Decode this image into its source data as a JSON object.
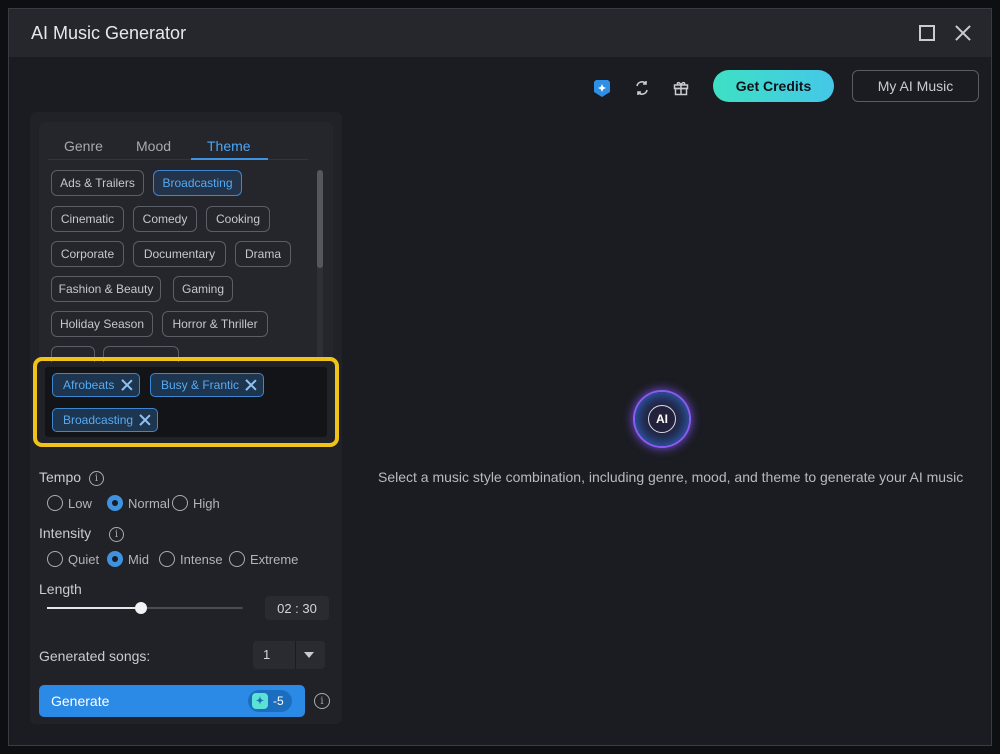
{
  "window": {
    "title": "AI Music Generator"
  },
  "toolbar": {
    "get_credits": "Get Credits",
    "my_ai_music": "My AI Music"
  },
  "tabs": [
    "Genre",
    "Mood",
    "Theme"
  ],
  "theme_chips": [
    {
      "label": "Ads & Trailers",
      "selected": false
    },
    {
      "label": "Broadcasting",
      "selected": true
    },
    {
      "label": "Cinematic",
      "selected": false
    },
    {
      "label": "Comedy",
      "selected": false
    },
    {
      "label": "Cooking",
      "selected": false
    },
    {
      "label": "Corporate",
      "selected": false
    },
    {
      "label": "Documentary",
      "selected": false
    },
    {
      "label": "Drama",
      "selected": false
    },
    {
      "label": "Fashion & Beauty",
      "selected": false
    },
    {
      "label": "Gaming",
      "selected": false
    },
    {
      "label": "Holiday Season",
      "selected": false
    },
    {
      "label": "Horror & Thriller",
      "selected": false
    }
  ],
  "selected_tags": [
    "Afrobeats",
    "Busy & Frantic",
    "Broadcasting"
  ],
  "tempo": {
    "label": "Tempo",
    "options": [
      "Low",
      "Normal",
      "High"
    ],
    "selected": "Normal"
  },
  "intensity": {
    "label": "Intensity",
    "options": [
      "Quiet",
      "Mid",
      "Intense",
      "Extreme"
    ],
    "selected": "Mid"
  },
  "length": {
    "label": "Length",
    "value": "02 : 30",
    "slider_fraction": 0.48
  },
  "generated_songs": {
    "label": "Generated songs:",
    "value": "1"
  },
  "generate": {
    "label": "Generate",
    "cost": "-5"
  },
  "main": {
    "hint": "Select a music style combination, including genre, mood, and theme to generate your AI music",
    "logo_text": "AI"
  },
  "colors": {
    "accent": "#2b8ae6",
    "credits_gradient": [
      "#3de0c4",
      "#45c7e8"
    ],
    "highlight_border": "#f0c21a"
  }
}
